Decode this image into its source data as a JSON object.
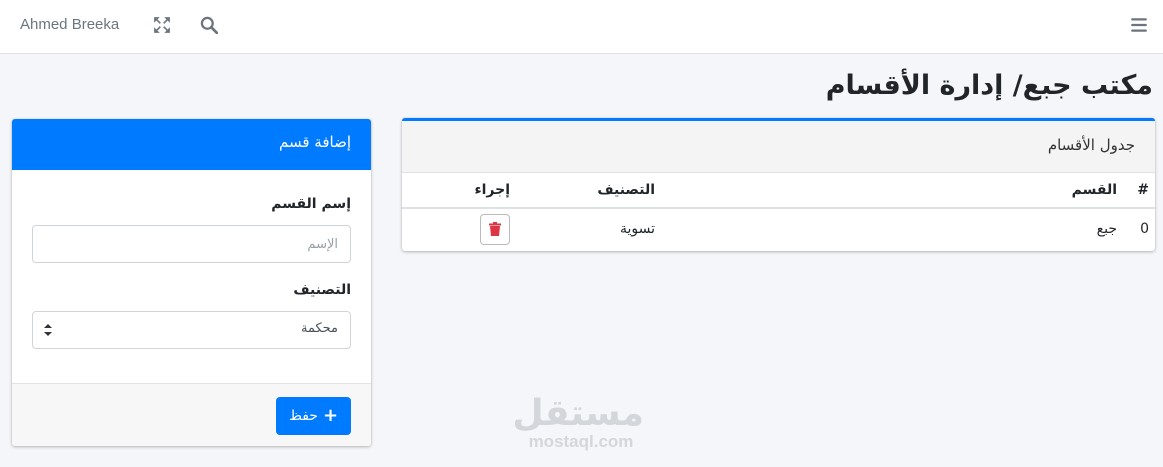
{
  "navbar": {
    "user_name": "Ahmed Breeka",
    "icons": [
      "expand-icon",
      "search-icon",
      "hamburger-icon"
    ]
  },
  "page": {
    "title": "مكتب جبع/ إدارة الأقسام"
  },
  "form_card": {
    "title": "إضافة قسم",
    "name_label": "إسم القسم",
    "name_placeholder": "الإسم",
    "name_value": "",
    "classification_label": "التصنيف",
    "classification_selected": "محكمة",
    "save_label": "حفظ"
  },
  "table_card": {
    "title": "جدول الأقسام",
    "headers": {
      "num": "#",
      "department": "القسم",
      "classification": "التصنيف",
      "action": "إجراء"
    },
    "rows": [
      {
        "num": "0",
        "department": "جبع",
        "classification": "تسوية"
      }
    ]
  },
  "watermark": {
    "logo": "مستقل",
    "url": "mostaql.com"
  },
  "colors": {
    "primary": "#007bff",
    "danger": "#dc3545",
    "background": "#f4f6f9"
  }
}
